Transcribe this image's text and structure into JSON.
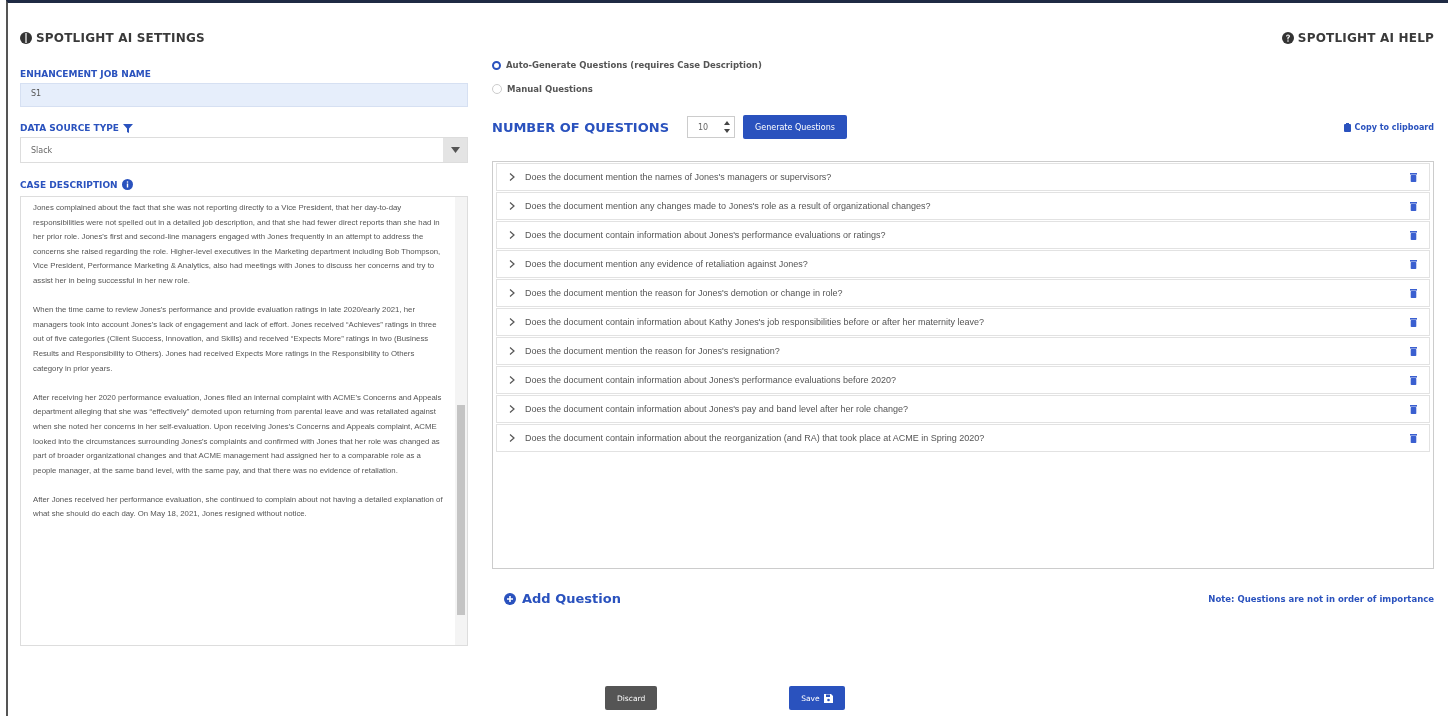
{
  "header": {
    "title": "SPOTLIGHT AI SETTINGS",
    "help_link": "SPOTLIGHT AI HELP"
  },
  "job_name": {
    "label": "ENHANCEMENT JOB NAME",
    "value": "S1"
  },
  "data_source": {
    "label": "DATA SOURCE TYPE",
    "value": "Slack"
  },
  "case_description": {
    "label": "CASE DESCRIPTION",
    "paragraphs": [
      "Jones complained about the fact that she was not reporting directly to a Vice President, that her day-to-day responsibilities were not spelled out in a detailed job description, and that she had fewer direct reports than she had in her prior role.  Jones's first and second-line managers engaged with Jones frequently in an attempt to address the concerns she raised regarding the role.  Higher-level executives in the Marketing department including Bob Thompson, Vice President, Performance Marketing & Analytics, also had meetings with Jones to discuss her concerns and try to assist her in being successful in her new role.",
      "When the time came to review Jones's performance and provide evaluation ratings in late 2020/early 2021, her managers took into account Jones's lack of engagement and lack of effort.  Jones received “Achieves” ratings in three out of five categories (Client Success, Innovation, and Skills) and received “Expects More” ratings in two (Business Results and Responsibility to Others).  Jones had received Expects More ratings in the Responsibility to Others category in prior years.",
      "After receiving her 2020 performance evaluation, Jones filed an internal complaint with ACME's Concerns and Appeals department alleging that she was “effectively” demoted upon returning from parental leave and was retaliated against when she noted her concerns in her self-evaluation.  Upon receiving Jones's Concerns and Appeals complaint, ACME looked into the circumstances surrounding Jones's complaints and confirmed with Jones that her role was changed as part of broader organizational changes and that ACME management had assigned her to a comparable role as a people manager, at the same band level, with the same pay, and that there was no evidence of retaliation.",
      "After Jones received her performance evaluation, she continued to complain about not having a detailed explanation of what she should do each day. On May 18, 2021, Jones resigned without notice."
    ]
  },
  "question_mode": [
    {
      "label": "Auto-Generate Questions (requires Case Description)",
      "selected": true
    },
    {
      "label": "Manual Questions",
      "selected": false
    }
  ],
  "number_of_questions": {
    "label": "NUMBER OF QUESTIONS",
    "value": "10",
    "generate_button": "Generate Questions",
    "copy_link": "Copy to clipboard"
  },
  "questions": [
    {
      "text": "Does the document mention the names of Jones's managers or supervisors?",
      "expanded": false
    },
    {
      "text": "Does the document mention any changes made to Jones's role as a result of organizational changes?",
      "expanded": false
    },
    {
      "text": "Does the document contain information about Jones's performance evaluations or ratings?",
      "expanded": false
    },
    {
      "text": "Does the document mention any evidence of retaliation against Jones?",
      "expanded": false
    },
    {
      "text": "Does the document mention the reason for Jones's demotion or change in role?",
      "expanded": false
    },
    {
      "text": "Does the document contain information about Kathy Jones's job responsibilities before or after her maternity leave?",
      "expanded": false
    },
    {
      "text": "Does the document mention the reason for Jones's resignation?",
      "expanded": false
    },
    {
      "text": "Does the document contain information about Jones's performance evaluations before 2020?",
      "expanded": false
    },
    {
      "text": "Does the document contain information about Jones's pay and band level after her role change?",
      "expanded": false
    },
    {
      "text": "Does the document contain information about the reorganization (and RA) that took place at ACME in Spring 2020?",
      "expanded": false
    }
  ],
  "add_question": "Add Question",
  "note": "Note: Questions are not in order of importance",
  "buttons": [
    {
      "label": "Discard",
      "kind": "secondary"
    },
    {
      "label": "Save",
      "kind": "primary"
    }
  ]
}
